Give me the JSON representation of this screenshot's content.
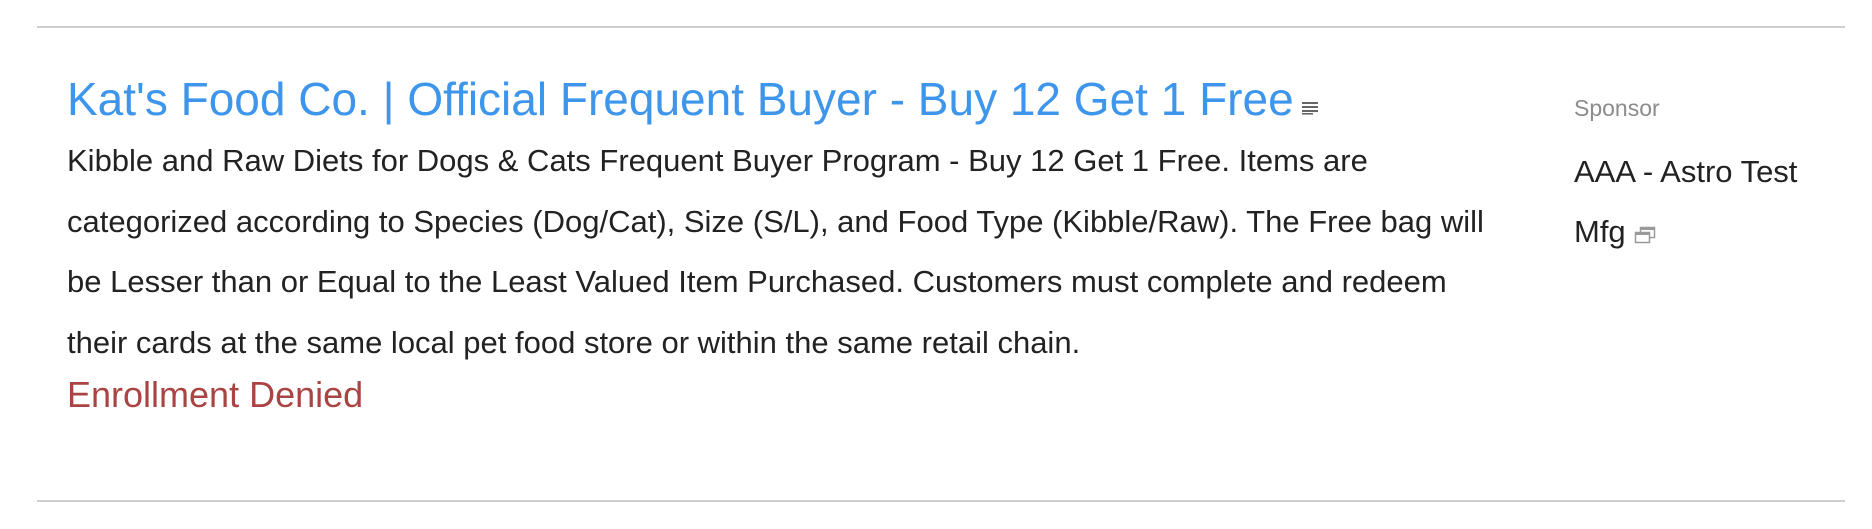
{
  "program": {
    "title": "Kat's Food Co. | Official Frequent Buyer - Buy 12 Get 1 Free",
    "details_icon": "list-lines-icon",
    "description": "Kibble and Raw Diets for Dogs & Cats Frequent Buyer Program - Buy 12 Get 1 Free. Items are categorized according to Species (Dog/Cat), Size (S/L), and Food Type (Kibble/Raw). The Free bag will be Lesser than or Equal to the Least Valued Item Purchased. Customers must complete and redeem their cards at the same local pet food store or within the same retail chain.",
    "status": "Enrollment Denied"
  },
  "sponsor": {
    "label": "Sponsor",
    "name": "AAA - Astro Test Mfg",
    "link_icon": "open-in-new-window-icon"
  },
  "colors": {
    "title_link": "#3d96eb",
    "status_denied": "#a94442",
    "body_text": "#222222",
    "muted_text": "#8c8c8c",
    "divider": "#cfcfcf"
  }
}
